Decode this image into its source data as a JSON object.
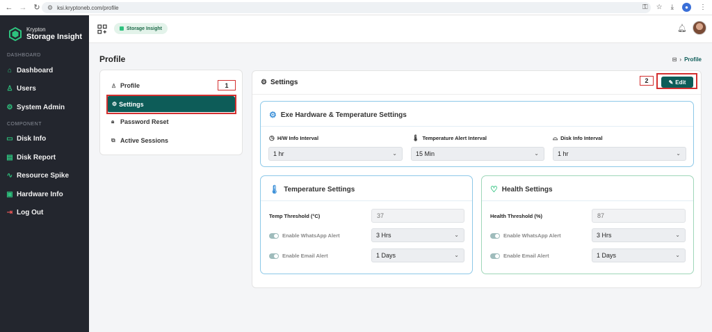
{
  "browser": {
    "url": "ksi.kryptoneb.com/profile",
    "back_icon": "arrow-left-icon",
    "forward_icon": "arrow-right-icon",
    "reload_icon": "reload-icon"
  },
  "sidebar": {
    "brand_line1": "Krypton",
    "brand_line2": "Storage Insight",
    "section_dashboard": "DASHBOARD",
    "section_component": "COMPONENT",
    "items": [
      {
        "label": "Dashboard",
        "icon": "home-icon"
      },
      {
        "label": "Users",
        "icon": "user-icon"
      },
      {
        "label": "System Admin",
        "icon": "settings-icon"
      },
      {
        "label": "Disk Info",
        "icon": "disk-icon"
      },
      {
        "label": "Disk Report",
        "icon": "report-icon"
      },
      {
        "label": "Resource Spike",
        "icon": "pulse-icon"
      },
      {
        "label": "Hardware Info",
        "icon": "hardware-icon"
      },
      {
        "label": "Log Out",
        "icon": "logout-icon"
      }
    ]
  },
  "topbar": {
    "app_chip": "Storage Insight"
  },
  "page": {
    "title": "Profile",
    "breadcrumb_current": "Profile"
  },
  "menu": {
    "items": [
      "Profile",
      "Settings",
      "Password Reset",
      "Active Sessions"
    ],
    "active": "Settings"
  },
  "annotations": {
    "badge1": "1",
    "badge2": "2"
  },
  "settings": {
    "title": "Settings",
    "edit_label": "Edit",
    "hardware": {
      "title": "Exe Hardware & Temperature Settings",
      "hw_label": "H/W Info Interval",
      "hw_value": "1 hr",
      "temp_label": "Temperature Alert Interval",
      "temp_value": "15 Min",
      "disk_label": "Disk Info Interval",
      "disk_value": "1 hr"
    },
    "temperature": {
      "title": "Temperature Settings",
      "threshold_label": "Temp Threshold (°C)",
      "threshold_value": "37",
      "whatsapp_label": "Enable WhatsApp Alert",
      "whatsapp_value": "3 Hrs",
      "email_label": "Enable Email Alert",
      "email_value": "1 Days"
    },
    "health": {
      "title": "Health Settings",
      "threshold_label": "Health Threshold (%)",
      "threshold_value": "87",
      "whatsapp_label": "Enable WhatsApp Alert",
      "whatsapp_value": "3 Hrs",
      "email_label": "Enable Email Alert",
      "email_value": "1 Days"
    }
  },
  "colors": {
    "primary": "#0d5c58",
    "sidebar_bg": "#23262e",
    "accent_green": "#2ec27e",
    "panel_border": "#8cc8e8",
    "annotation_red": "#d32f2f"
  }
}
